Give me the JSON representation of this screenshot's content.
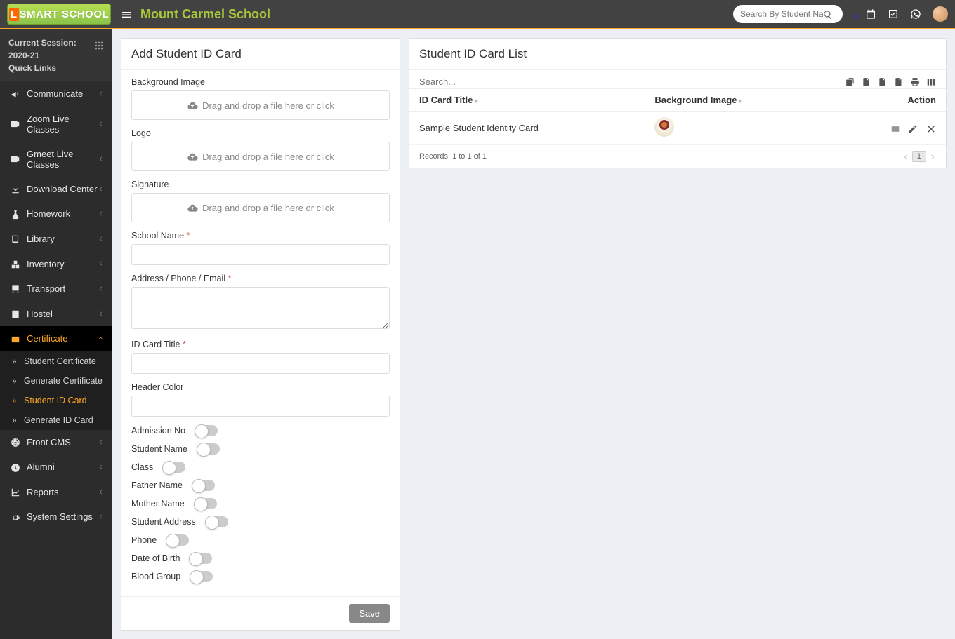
{
  "topbar": {
    "logo": "SMART SCHOOL",
    "school": "Mount Carmel School",
    "search_placeholder": "Search By Student Name"
  },
  "session": {
    "line1": "Current Session: 2020-21",
    "line2": "Quick Links"
  },
  "nav": [
    {
      "icon": "bullhorn",
      "label": "Communicate"
    },
    {
      "icon": "video",
      "label": "Zoom Live Classes"
    },
    {
      "icon": "video",
      "label": "Gmeet Live Classes"
    },
    {
      "icon": "download",
      "label": "Download Center"
    },
    {
      "icon": "flask",
      "label": "Homework"
    },
    {
      "icon": "book",
      "label": "Library"
    },
    {
      "icon": "boxes",
      "label": "Inventory"
    },
    {
      "icon": "bus",
      "label": "Transport"
    },
    {
      "icon": "building",
      "label": "Hostel"
    },
    {
      "icon": "id",
      "label": "Certificate",
      "active": true,
      "children": [
        {
          "label": "Student Certificate"
        },
        {
          "label": "Generate Certificate"
        },
        {
          "label": "Student ID Card",
          "active": true
        },
        {
          "label": "Generate ID Card"
        }
      ]
    },
    {
      "icon": "globe",
      "label": "Front CMS"
    },
    {
      "icon": "clock",
      "label": "Alumni"
    },
    {
      "icon": "chart",
      "label": "Reports"
    },
    {
      "icon": "cogs",
      "label": "System Settings"
    }
  ],
  "form": {
    "title": "Add Student ID Card",
    "bg_label": "Background Image",
    "logo_label": "Logo",
    "sig_label": "Signature",
    "drop_text": "Drag and drop a file here or click",
    "school_label": "School Name",
    "addr_label": "Address / Phone / Email",
    "idtitle_label": "ID Card Title",
    "header_color_label": "Header Color",
    "toggles": [
      "Admission No",
      "Student Name",
      "Class",
      "Father Name",
      "Mother Name",
      "Student Address",
      "Phone",
      "Date of Birth",
      "Blood Group"
    ],
    "save": "Save"
  },
  "list": {
    "title": "Student ID Card List",
    "search_placeholder": "Search...",
    "col_title": "ID Card Title",
    "col_bg": "Background Image",
    "col_action": "Action",
    "row_title": "Sample Student Identity Card",
    "records": "Records: 1 to 1 of 1",
    "page": "1"
  }
}
